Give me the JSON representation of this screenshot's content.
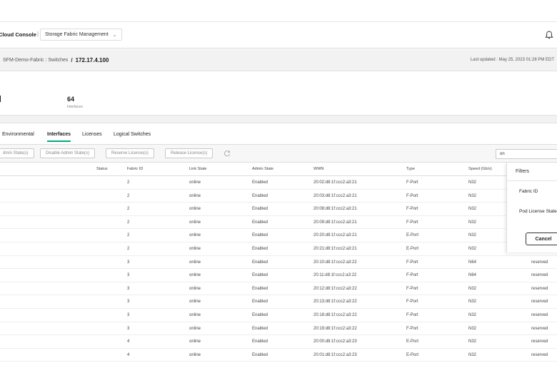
{
  "app": {
    "title": "Cloud Console",
    "separator": "|",
    "menu_label": "Storage Fabric Management",
    "menu_chevron": "⌄",
    "notification_icon": "bell-icon"
  },
  "breadcrumb": {
    "path": "SFM-Demo-Fabric : Switches",
    "slash": "/",
    "current": "172.17.4.100",
    "last_updated": "Last updated : May 25, 2023 01:28 PM EDT"
  },
  "summary": {
    "interfaces_count": "64",
    "interfaces_label": "Interfaces"
  },
  "tabs": [
    {
      "label": "Environmental",
      "active": false
    },
    {
      "label": "Interfaces",
      "active": true
    },
    {
      "label": "Licenses",
      "active": false
    },
    {
      "label": "Logical Switches",
      "active": false
    }
  ],
  "toolbar": {
    "enable_admin": "dmin State(s)",
    "disable_admin": "Disable Admin State(s)",
    "reserve_license": "Reserve License(s)",
    "release_license": "Release License(s)",
    "refresh_icon": "refresh-icon",
    "search_value": "on"
  },
  "table": {
    "headers": [
      "Status",
      "Fabric ID",
      "Link State",
      "Admin State",
      "WWN",
      "Type",
      "Speed (Gb/s)"
    ],
    "rows": [
      {
        "fabric_id": "2",
        "link": "online",
        "admin": "Enabled",
        "wwn": "20:02:d8:1f:ccc2:a3:21",
        "type": "F-Port",
        "speed": "N32",
        "license": ""
      },
      {
        "fabric_id": "2",
        "link": "online",
        "admin": "Enabled",
        "wwn": "20:03:d8:1f:ccc2:a3:21",
        "type": "F-Port",
        "speed": "N32",
        "license": ""
      },
      {
        "fabric_id": "2",
        "link": "online",
        "admin": "Enabled",
        "wwn": "20:08:d8:1f:ccc2:a3:21",
        "type": "F-Port",
        "speed": "N32",
        "license": ""
      },
      {
        "fabric_id": "2",
        "link": "online",
        "admin": "Enabled",
        "wwn": "20:09:d8:1f:ccc2:a3:21",
        "type": "F-Port",
        "speed": "N32",
        "license": ""
      },
      {
        "fabric_id": "2",
        "link": "online",
        "admin": "Enabled",
        "wwn": "20:20:d8:1f:ccc2:a3:21",
        "type": "E-Port",
        "speed": "N32",
        "license": ""
      },
      {
        "fabric_id": "2",
        "link": "online",
        "admin": "Enabled",
        "wwn": "20:21:d8:1f:ccc2:a3:21",
        "type": "E-Port",
        "speed": "N32",
        "license": ""
      },
      {
        "fabric_id": "3",
        "link": "online",
        "admin": "Enabled",
        "wwn": "20:10:d8:1f:ccc2:a3:22",
        "type": "F-Port",
        "speed": "N64",
        "license": "reserved"
      },
      {
        "fabric_id": "3",
        "link": "online",
        "admin": "Enabled",
        "wwn": "20:11:d8:1f:ccc2:a3:22",
        "type": "F-Port",
        "speed": "N64",
        "license": "reserved"
      },
      {
        "fabric_id": "3",
        "link": "online",
        "admin": "Enabled",
        "wwn": "20:12:d8:1f:ccc2:a3:22",
        "type": "F-Port",
        "speed": "N32",
        "license": "reserved"
      },
      {
        "fabric_id": "3",
        "link": "online",
        "admin": "Enabled",
        "wwn": "20:13:d8:1f:ccc2:a3:22",
        "type": "F-Port",
        "speed": "N32",
        "license": "reserved"
      },
      {
        "fabric_id": "3",
        "link": "online",
        "admin": "Enabled",
        "wwn": "20:18:d8:1f:ccc2:a3:22",
        "type": "F-Port",
        "speed": "N32",
        "license": "reserved"
      },
      {
        "fabric_id": "3",
        "link": "online",
        "admin": "Enabled",
        "wwn": "20:19:d8:1f:ccc2:a3:22",
        "type": "F-Port",
        "speed": "N32",
        "license": "reserved"
      },
      {
        "fabric_id": "4",
        "link": "online",
        "admin": "Enabled",
        "wwn": "20:00:d8:1f:ccc2:a3:23",
        "type": "E-Port",
        "speed": "N32",
        "license": "reserved"
      },
      {
        "fabric_id": "4",
        "link": "online",
        "admin": "Enabled",
        "wwn": "20:01:d8:1f:ccc2:a3:23",
        "type": "E-Port",
        "speed": "N32",
        "license": "reserved"
      }
    ]
  },
  "filters": {
    "title": "Filters",
    "items": [
      "Fabric ID",
      "Pod License State"
    ],
    "cancel_label": "Cancel"
  },
  "colors": {
    "accent": "#01a982",
    "header_bg": "#f2f2f2"
  }
}
